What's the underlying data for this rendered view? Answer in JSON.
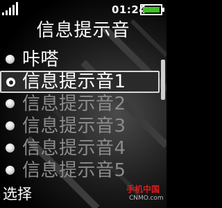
{
  "status": {
    "time": "01:24"
  },
  "title": "信息提示音",
  "items": [
    {
      "label": "咔嗒"
    },
    {
      "label": "信息提示音1"
    },
    {
      "label": "信息提示音2"
    },
    {
      "label": "信息提示音3"
    },
    {
      "label": "信息提示音4"
    },
    {
      "label": "信息提示音5"
    }
  ],
  "softkey": {
    "left": "选择"
  },
  "watermark": {
    "logo": "手机中国",
    "site": "CNMO.com"
  },
  "colors": {
    "background": "#000000",
    "text": "#ffffff",
    "dim_text": "#8c8c8c",
    "watermark_red": "#e01b1b"
  },
  "icons": {
    "signal": "signal-strength-icon",
    "battery": "battery-full-icon",
    "radio": "radio-button-icon"
  }
}
